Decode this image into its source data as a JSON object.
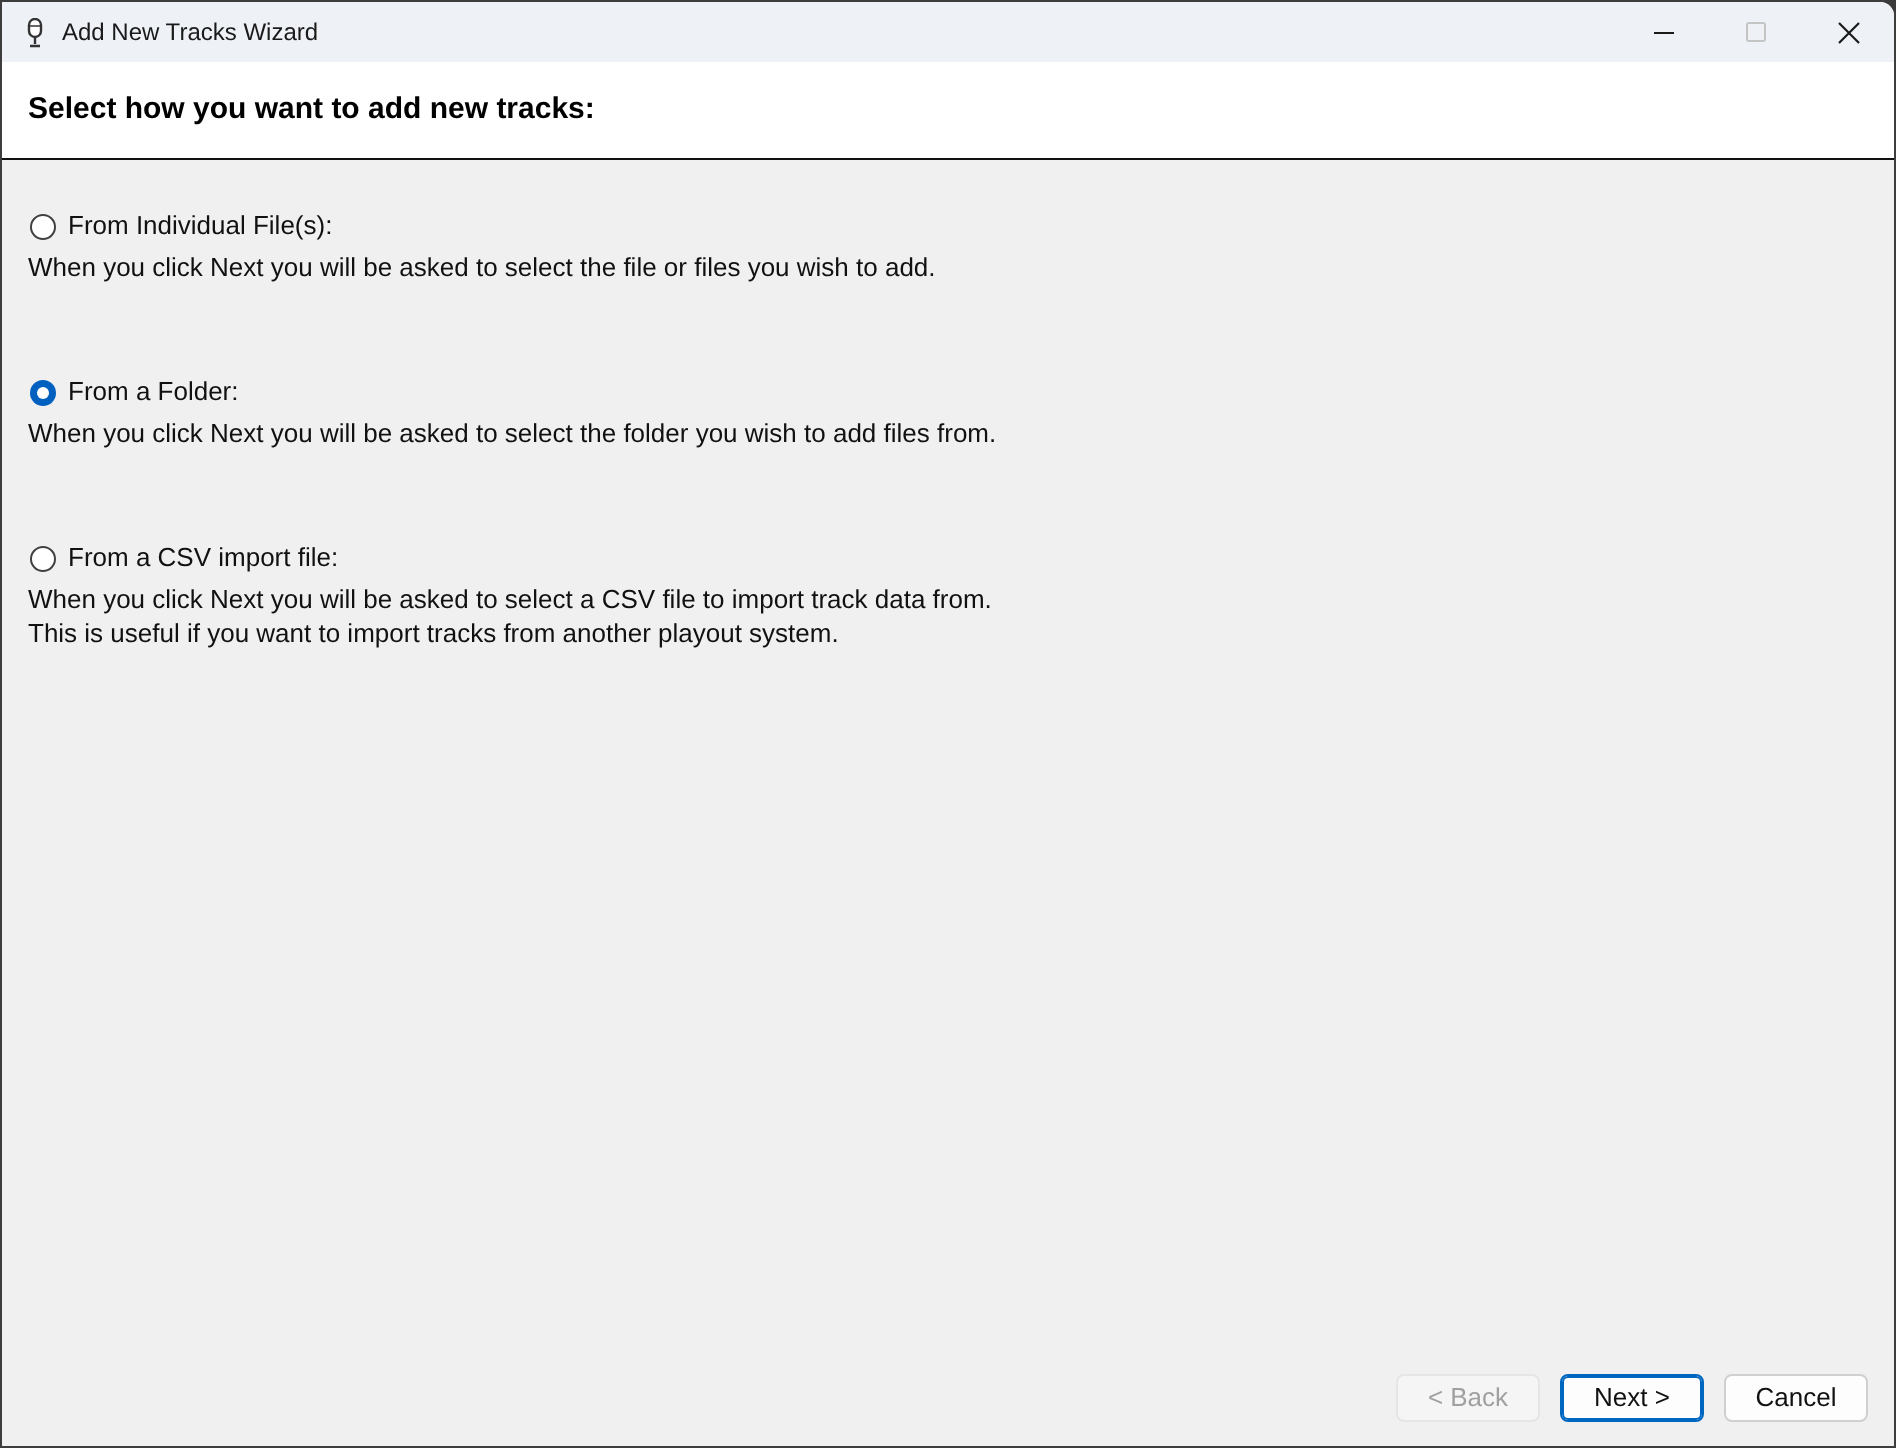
{
  "window": {
    "title": "Add New Tracks Wizard",
    "controls": [
      {
        "kind": "minimize",
        "disabled": false
      },
      {
        "kind": "maximize",
        "disabled": true
      },
      {
        "kind": "close",
        "disabled": false
      }
    ]
  },
  "header": {
    "title": "Select how you want to add new tracks:"
  },
  "options": [
    {
      "label": "From Individual File(s):",
      "selected": false,
      "description": [
        "When you click Next you will be asked to select the file or files you wish to add."
      ]
    },
    {
      "label": "From a Folder:",
      "selected": true,
      "description": [
        "When you click Next you will be asked to select the folder you wish to add files from."
      ]
    },
    {
      "label": "From a CSV import file:",
      "selected": false,
      "description": [
        "When you click Next you will be asked to select a CSV file to import track data from.",
        "This is useful if you want to import tracks from another playout system."
      ]
    }
  ],
  "buttons": [
    {
      "label": "< Back",
      "disabled": true,
      "default": false
    },
    {
      "label": "Next >",
      "disabled": false,
      "default": true
    },
    {
      "label": "Cancel",
      "disabled": false,
      "default": false
    }
  ]
}
